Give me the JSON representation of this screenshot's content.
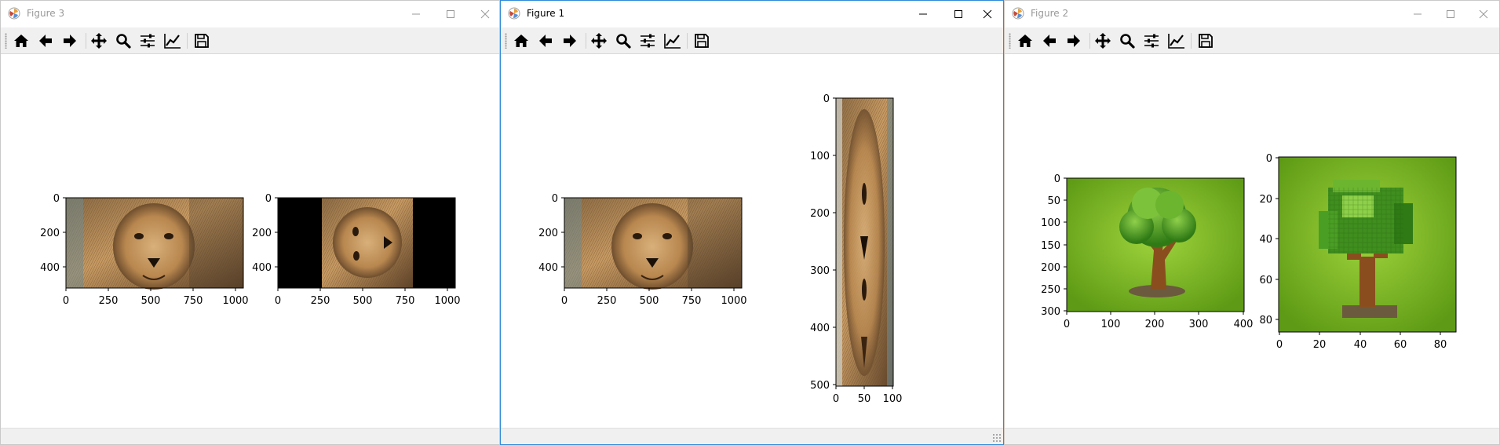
{
  "windows": [
    {
      "title": "Figure 3",
      "active": false,
      "axes": [
        {
          "image": "lion-face",
          "xticks": [
            "0",
            "250",
            "500",
            "750",
            "1000"
          ],
          "yticks": [
            "0",
            "200",
            "400"
          ]
        },
        {
          "image": "lion-face-rotated-90-black-padding",
          "xticks": [
            "0",
            "250",
            "500",
            "750",
            "1000"
          ],
          "yticks": [
            "0",
            "200",
            "400"
          ]
        }
      ]
    },
    {
      "title": "Figure 1",
      "active": true,
      "axes": [
        {
          "image": "lion-face",
          "xticks": [
            "0",
            "250",
            "500",
            "750",
            "1000"
          ],
          "yticks": [
            "0",
            "200",
            "400"
          ]
        },
        {
          "image": "lion-face-stretched-vertical",
          "xticks": [
            "0",
            "50",
            "100"
          ],
          "yticks": [
            "0",
            "100",
            "200",
            "300",
            "400",
            "500"
          ]
        }
      ]
    },
    {
      "title": "Figure 2",
      "active": false,
      "axes": [
        {
          "image": "cartoon-tree",
          "xticks": [
            "0",
            "100",
            "200",
            "300",
            "400"
          ],
          "yticks": [
            "0",
            "50",
            "100",
            "150",
            "200",
            "250",
            "300"
          ]
        },
        {
          "image": "cartoon-tree-pixelated",
          "xticks": [
            "0",
            "20",
            "40",
            "60",
            "80"
          ],
          "yticks": [
            "0",
            "20",
            "40",
            "60",
            "80"
          ]
        }
      ]
    }
  ],
  "toolbar_icons": [
    "home-icon",
    "back-arrow-icon",
    "forward-arrow-icon",
    "pan-move-icon",
    "zoom-magnifier-icon",
    "configure-subplots-icon",
    "edit-axis-icon",
    "save-floppy-icon"
  ],
  "colors": {
    "active_border": "#2f8bd8",
    "inactive_title": "#999999",
    "toolbar_bg": "#f0f0f0",
    "tree_background": "#6aa81e",
    "padding_black": "#000000"
  }
}
